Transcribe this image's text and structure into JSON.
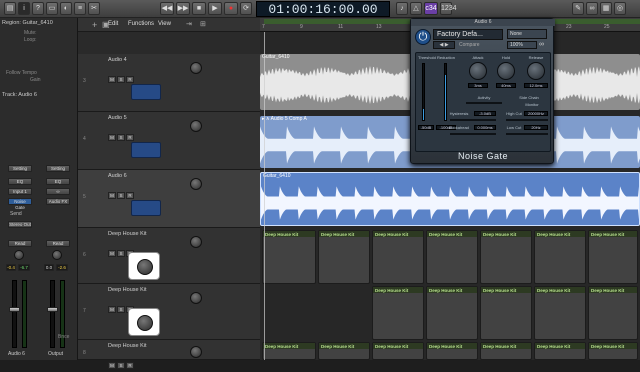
{
  "toolbar": {
    "edit": "Edit",
    "functions": "Functions",
    "view": "View",
    "transport_time": "01:00:16:00.00",
    "mode_badge": "c34"
  },
  "inspector": {
    "region_header": "Region: Guitar_6410",
    "params": [
      "Mute:",
      "Loop:",
      "",
      "",
      "Follow Tempo",
      "Gain"
    ],
    "track_header": "Track: Audio 6",
    "setting_labels": [
      "Setting",
      "Setting"
    ],
    "eq_labels": [
      "EQ",
      "EQ"
    ],
    "input_label": "Input 1",
    "noise_gate_slot": "Noise Gate",
    "audio_fx": "Audio FX",
    "send_label": "Send",
    "stereo_out": "Stereo Out",
    "read_labels": [
      "Read",
      "Read"
    ],
    "meter_values_left": [
      "-0.4",
      "-6.7"
    ],
    "meter_values_right": [
      "0.0",
      "-2.6"
    ],
    "channel_names": [
      "Audio 6",
      "Output"
    ],
    "bnce": "Bnce"
  },
  "tracks": [
    {
      "num": "3",
      "name": "Audio 4",
      "kind": "audio"
    },
    {
      "num": "4",
      "name": "Audio 5",
      "kind": "audio"
    },
    {
      "num": "5",
      "name": "Audio 6",
      "kind": "audio",
      "selected": true
    },
    {
      "num": "6",
      "name": "Deep House Kit",
      "kind": "drum"
    },
    {
      "num": "7",
      "name": "Deep House Kit",
      "kind": "drum"
    },
    {
      "num": "8",
      "name": "Deep House Kit",
      "kind": "drum"
    }
  ],
  "msr": [
    "M",
    "S",
    "R"
  ],
  "ruler_ticks": [
    "7",
    "9",
    "11",
    "13",
    "15",
    "17",
    "19",
    "21",
    "23",
    "25",
    "27"
  ],
  "regions": {
    "audio4": "Guitar_6410",
    "audio5": "▸ ∧ Audio 5 Comp A",
    "audio6": "Guitar_6410",
    "kit": "Deep House Kit"
  },
  "plugin": {
    "window_title": "Audio 6",
    "preset": "Factory Defa...",
    "side_chain_select": "None",
    "compare": "Compare",
    "zoom": "100%",
    "threshold_label": "Threshold",
    "reduction_label": "Reduction",
    "attack_label": "Attack",
    "hold_label": "Hold",
    "release_label": "Release",
    "attack_val": "3ms",
    "hold_val": "40ms",
    "release_val": "12.0ms",
    "threshold_val": "-50dB",
    "reduction_val": "-100dB",
    "activity_label": "Activity",
    "side_chain_label": "Side Chain",
    "monitor_label": "Monitor",
    "hysteresis_label": "Hysteresis",
    "hysteresis_val": "-3.0dB",
    "lookahead_label": "Lookahead",
    "lookahead_val": "0.000ms",
    "high_cut_label": "High Cut",
    "high_cut_val": "20000Hz",
    "low_cut_label": "Low Cut",
    "low_cut_val": "20Hz",
    "name": "Noise Gate"
  },
  "colors": {
    "audio_region": "#7f9ccc",
    "audio_region_selected": "#5b83c8",
    "kit_title": "#b6e08c",
    "accent_blue": "#3c9be0"
  }
}
